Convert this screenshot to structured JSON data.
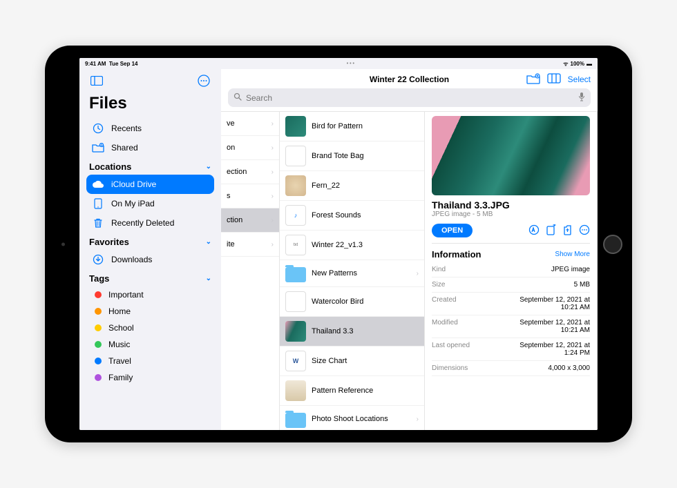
{
  "status": {
    "time": "9:41 AM",
    "date": "Tue Sep 14",
    "battery": "100%",
    "dots": "• • •"
  },
  "sidebar": {
    "title": "Files",
    "recents": "Recents",
    "shared": "Shared",
    "locations_label": "Locations",
    "icloud": "iCloud Drive",
    "onipad": "On My iPad",
    "deleted": "Recently Deleted",
    "favorites_label": "Favorites",
    "downloads": "Downloads",
    "tags_label": "Tags",
    "tags": [
      {
        "label": "Important",
        "color": "#ff3b30"
      },
      {
        "label": "Home",
        "color": "#ff9500"
      },
      {
        "label": "School",
        "color": "#ffcc00"
      },
      {
        "label": "Music",
        "color": "#34c759"
      },
      {
        "label": "Travel",
        "color": "#007aff"
      },
      {
        "label": "Family",
        "color": "#af52de"
      }
    ]
  },
  "header": {
    "title": "Winter 22 Collection",
    "select": "Select",
    "search_placeholder": "Search"
  },
  "col1": {
    "items": [
      "ve",
      "on",
      "ection",
      "s",
      "ction",
      "ite"
    ]
  },
  "col2": {
    "items": [
      {
        "label": "Bird for Pattern"
      },
      {
        "label": "Brand Tote Bag"
      },
      {
        "label": "Fern_22"
      },
      {
        "label": "Forest Sounds"
      },
      {
        "label": "Winter 22_v1.3"
      },
      {
        "label": "New Patterns",
        "folder": true
      },
      {
        "label": "Watercolor Bird"
      },
      {
        "label": "Thailand 3.3",
        "selected": true
      },
      {
        "label": "Size Chart"
      },
      {
        "label": "Pattern Reference"
      },
      {
        "label": "Photo Shoot Locations",
        "folder": true
      }
    ]
  },
  "detail": {
    "name": "Thailand 3.3.JPG",
    "sub": "JPEG image - 5 MB",
    "open": "OPEN",
    "info_label": "Information",
    "show_more": "Show More",
    "rows": [
      {
        "k": "Kind",
        "v": "JPEG image"
      },
      {
        "k": "Size",
        "v": "5 MB"
      },
      {
        "k": "Created",
        "v": "September 12, 2021 at 10:21 AM"
      },
      {
        "k": "Modified",
        "v": "September 12, 2021 at 10:21 AM"
      },
      {
        "k": "Last opened",
        "v": "September 12, 2021 at 1:24 PM"
      },
      {
        "k": "Dimensions",
        "v": "4,000 x 3,000"
      }
    ]
  }
}
